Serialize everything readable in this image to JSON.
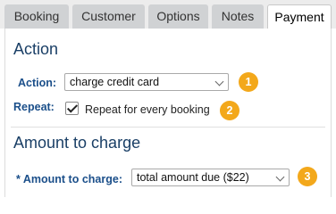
{
  "tabs": [
    {
      "label": "Booking"
    },
    {
      "label": "Customer"
    },
    {
      "label": "Options"
    },
    {
      "label": "Notes"
    },
    {
      "label": "Payment"
    }
  ],
  "active_tab": "Payment",
  "action_section": {
    "heading": "Action",
    "action_label": "Action:",
    "action_value": "charge credit card",
    "action_badge": "1",
    "repeat_label": "Repeat:",
    "repeat_checked": true,
    "repeat_text": "Repeat for every booking",
    "repeat_badge": "2"
  },
  "amount_section": {
    "heading": "Amount to charge",
    "amount_label": "* Amount to charge:",
    "amount_value": "total amount due ($22)",
    "amount_badge": "3"
  },
  "colors": {
    "badge": "#f3a81b",
    "label": "#1b4f8a",
    "heading": "#1a3f66"
  }
}
